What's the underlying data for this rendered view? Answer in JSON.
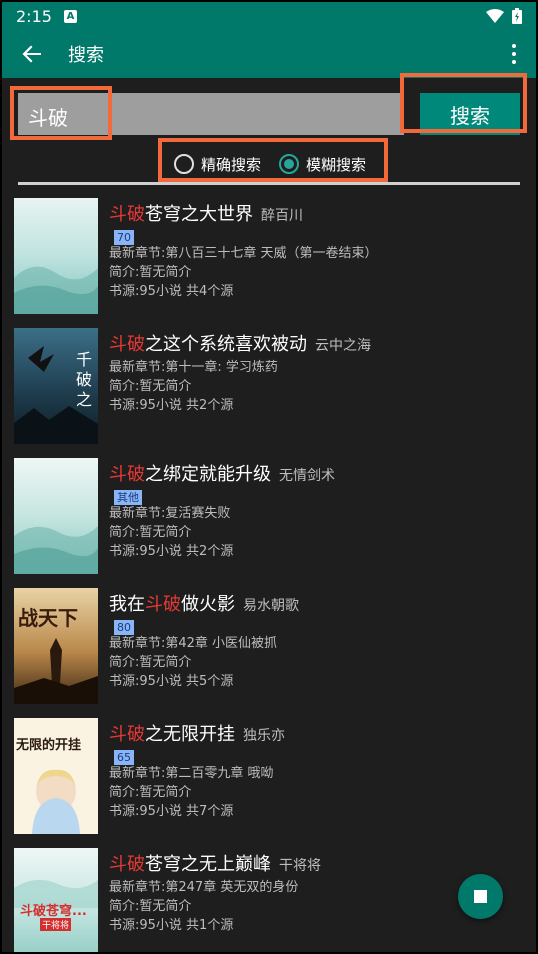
{
  "statusbar": {
    "time": "2:15",
    "notif": "A"
  },
  "appbar": {
    "title": "搜索"
  },
  "search": {
    "value": "斗破",
    "button": "搜索"
  },
  "options": {
    "exact": "精确搜索",
    "fuzzy": "模糊搜索",
    "selected": "fuzzy"
  },
  "results": [
    {
      "pre": "",
      "hl": "斗破",
      "post": "苍穹之大世界",
      "author": "醉百川",
      "tag": "70",
      "latest": "最新章节:第八百三十七章 天威（第一卷结束）",
      "intro": "简介:暂无简介",
      "source": "书源:95小说 共4个源"
    },
    {
      "pre": "",
      "hl": "斗破",
      "post": "之这个系统喜欢被动",
      "author": "云中之海",
      "tag": "",
      "latest": "最新章节:第十一章: 学习炼药",
      "intro": "简介:暂无简介",
      "source": "书源:95小说 共2个源"
    },
    {
      "pre": "",
      "hl": "斗破",
      "post": "之绑定就能升级",
      "author": "无情剑术",
      "tag": "其他",
      "latest": "最新章节:复活赛失败",
      "intro": "简介:暂无简介",
      "source": "书源:95小说 共2个源"
    },
    {
      "pre": "我在",
      "hl": "斗破",
      "post": "做火影",
      "author": "易水朝歌",
      "tag": "80",
      "latest": "最新章节:第42章 小医仙被抓",
      "intro": "简介:暂无简介",
      "source": "书源:95小说 共5个源"
    },
    {
      "pre": "",
      "hl": "斗破",
      "post": "之无限开挂",
      "author": "独乐亦",
      "tag": "65",
      "latest": "最新章节:第二百零九章 哦呦",
      "intro": "简介:暂无简介",
      "source": "书源:95小说 共7个源"
    },
    {
      "pre": "",
      "hl": "斗破",
      "post": "苍穹之无上巅峰",
      "author": "干将将",
      "tag": "",
      "latest": "最新章节:第247章 英无双的身份",
      "intro": "简介:暂无简介",
      "source": "书源:95小说 共1个源"
    }
  ],
  "covers": {
    "c2": "千破之",
    "c4": "战天下",
    "c5": "无限的开挂",
    "c6_title": "斗破苍穹...",
    "c6_author": "干将将"
  },
  "colors": {
    "primary": "#00796b",
    "accent": "#26a69a",
    "highlight": "#e53935",
    "annotation": "#f26a3b"
  },
  "icons": {
    "back": "arrow-left-icon",
    "more": "more-vert-icon",
    "stop": "stop-icon"
  }
}
